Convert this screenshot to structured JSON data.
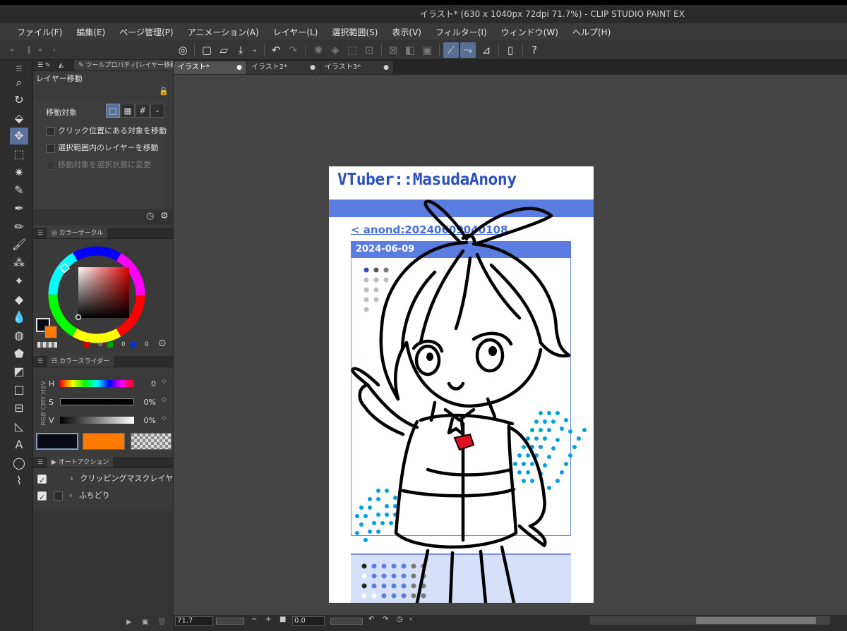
{
  "window": {
    "title": "イラスト* (630 x 1040px 72dpi 71.7%)  - CLIP STUDIO PAINT EX"
  },
  "menu": [
    "ファイル(F)",
    "編集(E)",
    "ページ管理(P)",
    "アニメーション(A)",
    "レイヤー(L)",
    "選択範囲(S)",
    "表示(V)",
    "フィルター(I)",
    "ウィンドウ(W)",
    "ヘルプ(H)"
  ],
  "tool_property": {
    "tab_label": "ツールプロパティ[レイヤー移動",
    "title": "レイヤー移動",
    "move_target_label": "移動対象",
    "options": [
      {
        "label": "クリック位置にある対象を移動",
        "checked": false,
        "enabled": true
      },
      {
        "label": "選択範囲内のレイヤーを移動",
        "checked": false,
        "enabled": true
      },
      {
        "label": "移動対象を選択状態に変更",
        "checked": false,
        "enabled": false
      }
    ]
  },
  "color_circle": {
    "tab_label": "カラーサークル",
    "rgb": [
      "0",
      "0",
      "0"
    ],
    "main_color": "#0a0a14",
    "sub_color": "#ff7a00"
  },
  "color_slider": {
    "tab_label": "カラースライダー",
    "modes_label": "RGB CMY HSV",
    "rows": [
      {
        "label": "H",
        "value": "0"
      },
      {
        "label": "S",
        "value": "0%"
      },
      {
        "label": "V",
        "value": "0%"
      }
    ]
  },
  "auto_action": {
    "tab_label": "オートアクション",
    "items": [
      {
        "label": "クリッピングマスクレイヤー",
        "checked": true
      },
      {
        "label": "ふちどり",
        "checked": true
      }
    ]
  },
  "documents": {
    "tabs": [
      {
        "label": "イラスト*",
        "active": true
      },
      {
        "label": "イラスト2*",
        "active": false
      },
      {
        "label": "イラスト3*",
        "active": false
      }
    ]
  },
  "canvas": {
    "title": "VTuber::MasudaAnony",
    "link": "< anond:20240609040108",
    "date": "2024-06-09"
  },
  "status": {
    "zoom": "71.7",
    "angle": "0.0"
  },
  "colors": {
    "accent": "#5c7199",
    "canvas_blue": "#5b7de2",
    "title_blue": "#2a4fc2",
    "dot_cyan": "#00a0e0"
  }
}
